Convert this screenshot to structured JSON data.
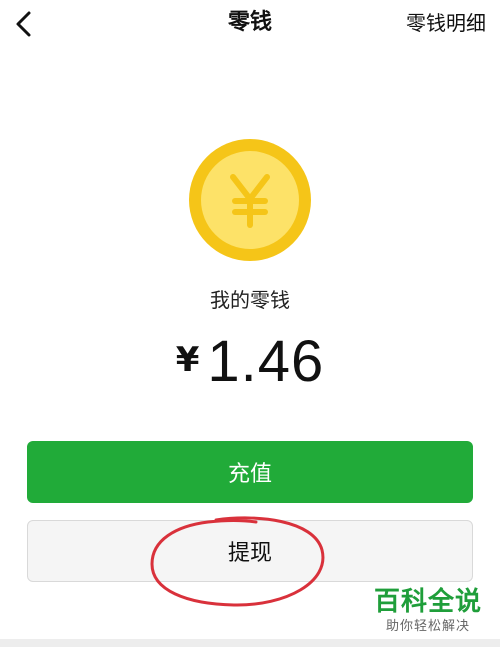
{
  "header": {
    "title": "零钱",
    "detail_link": "零钱明细"
  },
  "coin": {
    "symbol": "¥",
    "outer_color": "#f5c518",
    "inner_color": "#fde268"
  },
  "balance": {
    "label": "我的零钱",
    "currency": "¥",
    "amount": "1.46"
  },
  "actions": {
    "recharge_label": "充值",
    "withdraw_label": "提现"
  },
  "colors": {
    "primary_green": "#21ab39",
    "annotation_red": "#d9313b"
  },
  "watermark": {
    "title": "百科全说",
    "subtitle": "助你轻松解决"
  }
}
